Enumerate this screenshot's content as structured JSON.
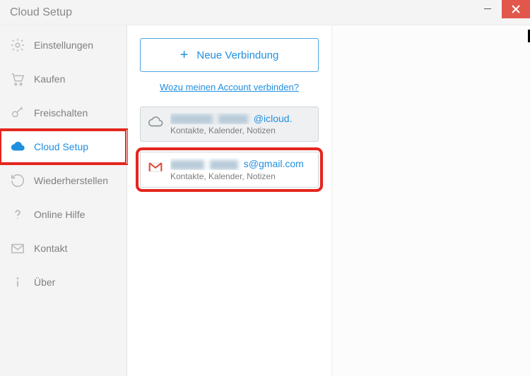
{
  "window": {
    "title": "Cloud Setup"
  },
  "sidebar": {
    "items": [
      {
        "label": "Einstellungen",
        "icon": "gear-icon"
      },
      {
        "label": "Kaufen",
        "icon": "cart-icon"
      },
      {
        "label": "Freischalten",
        "icon": "key-icon"
      },
      {
        "label": "Cloud Setup",
        "icon": "cloud-icon",
        "active": true,
        "highlighted": true
      },
      {
        "label": "Wiederherstellen",
        "icon": "restore-icon"
      },
      {
        "label": "Online Hilfe",
        "icon": "help-icon"
      },
      {
        "label": "Kontakt",
        "icon": "mail-icon"
      },
      {
        "label": "Über",
        "icon": "info-icon"
      }
    ]
  },
  "main": {
    "new_connection_label": "Neue Verbindung",
    "why_link_label": "Wozu meinen Account verbinden?",
    "accounts": [
      {
        "provider": "icloud",
        "email_obscured_prefix": "",
        "email_visible_suffix": "@icloud.",
        "subtitle": "Kontakte, Kalender, Notizen"
      },
      {
        "provider": "gmail",
        "email_obscured_prefix": "",
        "email_visible_suffix": "s@gmail.com",
        "subtitle": "Kontakte, Kalender, Notizen",
        "highlighted": true
      }
    ]
  }
}
